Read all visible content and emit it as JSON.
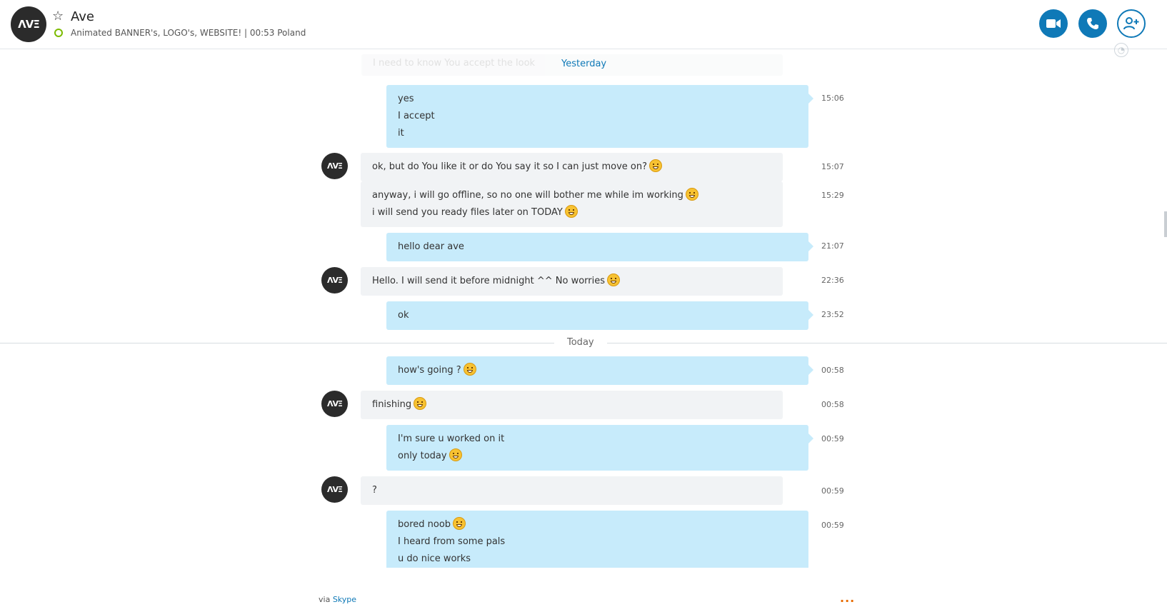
{
  "header": {
    "avatar_text": "ΛVΞ",
    "contact_name": "Ave",
    "mood": "Animated BANNER's, LOGO's, WEBSITE! | 00:53 Poland",
    "buttons": {
      "video": "video-call",
      "audio": "audio-call",
      "add": "add-people"
    }
  },
  "colors": {
    "accent": "#0f79b7",
    "outgoing_bubble": "#c7ebfb",
    "incoming_bubble": "#f1f3f5",
    "status_online": "#7cbb00",
    "more_dots": "#e86b00"
  },
  "icons": {
    "favorite": "star-icon",
    "video": "video-camera-icon",
    "phone": "phone-icon",
    "add_person": "add-person-icon",
    "globe": "globe-icon"
  },
  "faded_message": "I need to know You accept the look",
  "days": {
    "yesterday": "Yesterday",
    "today": "Today"
  },
  "messages": [
    {
      "dir": "out",
      "lines": [
        "yes",
        "I accept",
        "it"
      ],
      "time": "15:06"
    },
    {
      "dir": "in",
      "lines": [
        "ok, but do You like it or do You say it so I can just move on?"
      ],
      "time": "15:07"
    },
    {
      "dir": "in",
      "lines": [
        "anyway, i will go offline, so no one will bother me while im working",
        "i will send you ready files later on TODAY"
      ],
      "time": "15:29"
    },
    {
      "dir": "out",
      "lines": [
        "hello dear ave"
      ],
      "time": "21:07"
    },
    {
      "dir": "in",
      "lines": [
        "Hello. I will send it before midnight ^^ No worries"
      ],
      "time": "22:36"
    },
    {
      "dir": "out",
      "lines": [
        "ok"
      ],
      "time": "23:52"
    },
    {
      "dir": "out",
      "lines": [
        "how's going ?"
      ],
      "time": "00:58"
    },
    {
      "dir": "in",
      "lines": [
        "finishing"
      ],
      "time": "00:58"
    },
    {
      "dir": "out",
      "lines": [
        "I'm sure u worked on it",
        "only today"
      ],
      "time": "00:59"
    },
    {
      "dir": "in",
      "lines": [
        "?"
      ],
      "time": "00:59"
    },
    {
      "dir": "out",
      "lines": [
        "bored noob",
        "I heard from some pals",
        "u do nice works"
      ],
      "time": "00:59"
    }
  ],
  "footer": {
    "via": "via",
    "skype": "Skype",
    "more": "..."
  }
}
